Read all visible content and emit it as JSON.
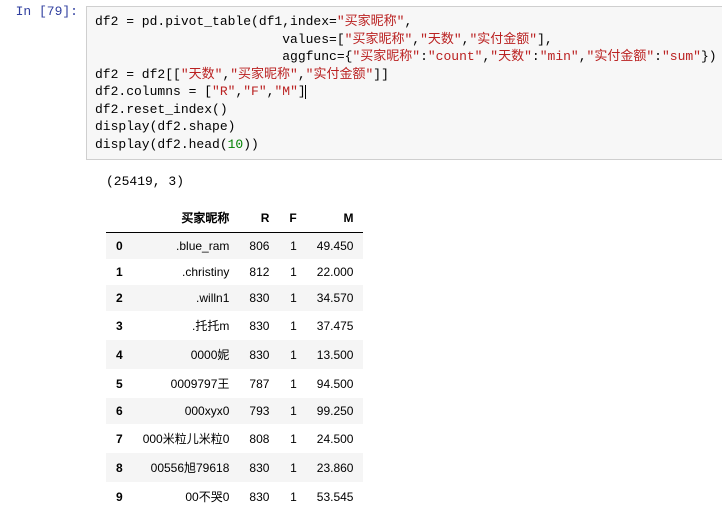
{
  "prompt": "In  [79]:",
  "code": {
    "l1a": "df2 = pd.pivot_table(df1,index=",
    "l1b": "\"买家昵称\"",
    "l1c": ",",
    "l2a": "                        values=[",
    "l2b": "\"买家昵称\"",
    "l2c": ",",
    "l2d": "\"天数\"",
    "l2e": ",",
    "l2f": "\"实付金额\"",
    "l2g": "],",
    "l3a": "                        aggfunc={",
    "l3b": "\"买家昵称\"",
    "l3c": ":",
    "l3d": "\"count\"",
    "l3e": ",",
    "l3f": "\"天数\"",
    "l3g": ":",
    "l3h": "\"min\"",
    "l3i": ",",
    "l3j": "\"实付金额\"",
    "l3k": ":",
    "l3l": "\"sum\"",
    "l3m": "})",
    "l4a": "df2 = df2[[",
    "l4b": "\"天数\"",
    "l4c": ",",
    "l4d": "\"买家昵称\"",
    "l4e": ",",
    "l4f": "\"实付金额\"",
    "l4g": "]]",
    "l5a": "df2.columns = [",
    "l5b": "\"R\"",
    "l5c": ",",
    "l5d": "\"F\"",
    "l5e": ",",
    "l5f": "\"M\"",
    "l5g": "]",
    "l6": "df2.reset_index()",
    "l7": "display(df2.shape)",
    "l8a": "display(df2.head(",
    "l8b": "10",
    "l8c": "))"
  },
  "shape_output": "(25419, 3)",
  "table": {
    "headers": [
      "",
      "买家昵称",
      "R",
      "F",
      "M"
    ],
    "rows": [
      {
        "idx": "0",
        "name": ".blue_ram",
        "r": "806",
        "f": "1",
        "m": "49.450"
      },
      {
        "idx": "1",
        "name": ".christiny",
        "r": "812",
        "f": "1",
        "m": "22.000"
      },
      {
        "idx": "2",
        "name": ".willn1",
        "r": "830",
        "f": "1",
        "m": "34.570"
      },
      {
        "idx": "3",
        "name": ".托托m",
        "r": "830",
        "f": "1",
        "m": "37.475"
      },
      {
        "idx": "4",
        "name": "0000妮",
        "r": "830",
        "f": "1",
        "m": "13.500"
      },
      {
        "idx": "5",
        "name": "0009797王",
        "r": "787",
        "f": "1",
        "m": "94.500"
      },
      {
        "idx": "6",
        "name": "000xyx0",
        "r": "793",
        "f": "1",
        "m": "99.250"
      },
      {
        "idx": "7",
        "name": "000米粒儿米粒0",
        "r": "808",
        "f": "1",
        "m": "24.500"
      },
      {
        "idx": "8",
        "name": "00556旭79618",
        "r": "830",
        "f": "1",
        "m": "23.860"
      },
      {
        "idx": "9",
        "name": "00不哭0",
        "r": "830",
        "f": "1",
        "m": "53.545"
      }
    ]
  }
}
